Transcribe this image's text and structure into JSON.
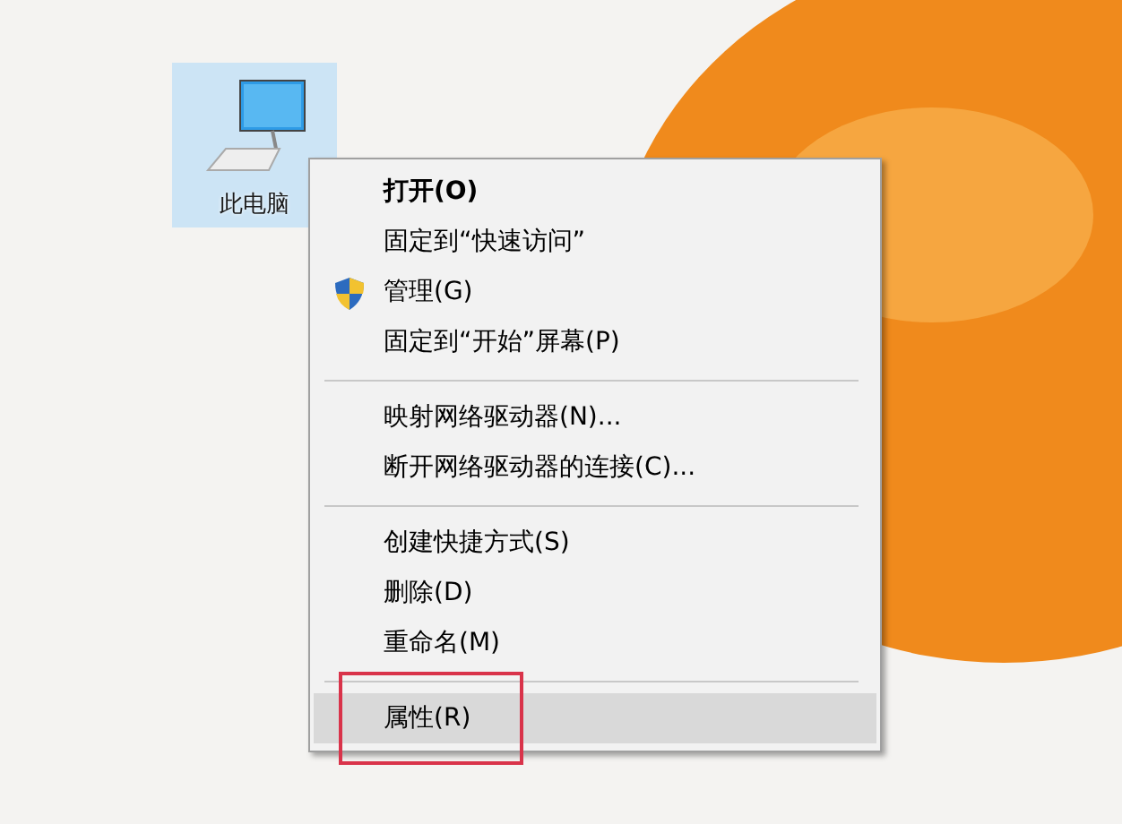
{
  "desktop_icon": {
    "label": "此电脑",
    "selected": true
  },
  "context_menu": {
    "items": [
      {
        "kind": "item",
        "label": "打开(O)",
        "default": true,
        "icon": false,
        "selected": false,
        "marked": false
      },
      {
        "kind": "item",
        "label": "固定到“快速访问”",
        "default": false,
        "icon": false,
        "selected": false,
        "marked": false
      },
      {
        "kind": "item",
        "label": "管理(G)",
        "default": false,
        "icon": true,
        "selected": false,
        "marked": false
      },
      {
        "kind": "item",
        "label": "固定到“开始”屏幕(P)",
        "default": false,
        "icon": false,
        "selected": false,
        "marked": false
      },
      {
        "kind": "separator"
      },
      {
        "kind": "item",
        "label": "映射网络驱动器(N)...",
        "default": false,
        "icon": false,
        "selected": false,
        "marked": false
      },
      {
        "kind": "item",
        "label": "断开网络驱动器的连接(C)...",
        "default": false,
        "icon": false,
        "selected": false,
        "marked": false
      },
      {
        "kind": "separator"
      },
      {
        "kind": "item",
        "label": "创建快捷方式(S)",
        "default": false,
        "icon": false,
        "selected": false,
        "marked": false
      },
      {
        "kind": "item",
        "label": "删除(D)",
        "default": false,
        "icon": false,
        "selected": false,
        "marked": false
      },
      {
        "kind": "item",
        "label": "重命名(M)",
        "default": false,
        "icon": false,
        "selected": false,
        "marked": false
      },
      {
        "kind": "separator"
      },
      {
        "kind": "item",
        "label": "属性(R)",
        "default": false,
        "icon": false,
        "selected": true,
        "marked": true
      }
    ]
  }
}
